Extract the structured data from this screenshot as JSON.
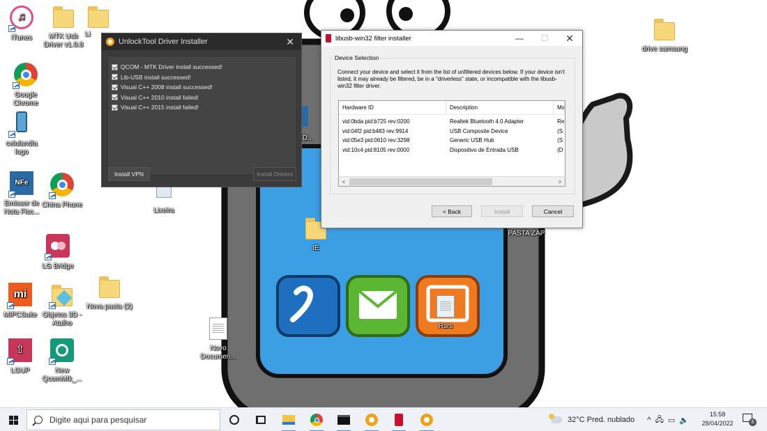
{
  "desktop": {
    "icons": [
      {
        "label": "iTunes"
      },
      {
        "label": "MTK Usb Driver v1.0.8"
      },
      {
        "label": "Li"
      },
      {
        "label": "Google Chrome"
      },
      {
        "label": "celulandia logo"
      },
      {
        "label": "Emissor de Nota Fisc..."
      },
      {
        "label": "China Phone"
      },
      {
        "label": "Lixeira"
      },
      {
        "label": "LG Bridge"
      },
      {
        "label": "MIPCSuite"
      },
      {
        "label": "Objetos 3D - Atalho"
      },
      {
        "label": "Nova pasta (2)"
      },
      {
        "label": "LGUP"
      },
      {
        "label": "New QcomMtk_..."
      },
      {
        "label": "Novo Documen..."
      },
      {
        "label": "IE"
      },
      {
        "label": "Rsrs"
      },
      {
        "label": "PASTA ZAP"
      },
      {
        "label": "drive samsung"
      },
      {
        "label": "CD..."
      }
    ]
  },
  "unlock_window": {
    "title": "UnlockTool Driver Installer",
    "close": "✕",
    "log": [
      "QCOM - MTK Driver install successed!",
      "Lib-USB install successed!",
      "Visual C++ 2008 install successed!",
      "Visual C++ 2010 install failed!",
      "Visual C++ 2015 install failed!"
    ],
    "install_vpn": "Install VPN",
    "install_drivers": "Install Drivers"
  },
  "libusb_window": {
    "title": "libusb-win32 filter installer",
    "minimize": "—",
    "maximize": "☐",
    "close": "✕",
    "group_title": "Device Selection",
    "instructions": "Connect your device and select it from the list of unfiltered devices below. If your device isn't listed, it may already be filtered, be in a \"driverless\" state, or incompatible with the libusb-win32 filter driver.",
    "columns": [
      "Hardware ID",
      "Description",
      "Ma"
    ],
    "rows": [
      [
        "vid:0bda pid:b725 rev:0200",
        "Realtek Bluetooth 4.0 Adapter",
        "Re"
      ],
      [
        "vid:04f2 pid:b483 rev:9914",
        "USB Composite Device",
        "(S"
      ],
      [
        "vid:05e3 pid:0610 rev:3298",
        "Generic USB Hub",
        "(S"
      ],
      [
        "vid:10c4 pid:8105 rev:0000",
        "Dispositivo de Entrada USB",
        "(D"
      ]
    ],
    "scroll_left": "<",
    "scroll_right": ">",
    "back": "< Back",
    "install": "Install",
    "cancel": "Cancel"
  },
  "taskbar": {
    "search_placeholder": "Digite aqui para pesquisar",
    "weather": "32°C  Pred. nublado",
    "time": "15:58",
    "date": "28/04/2022",
    "notification_count": "5"
  }
}
